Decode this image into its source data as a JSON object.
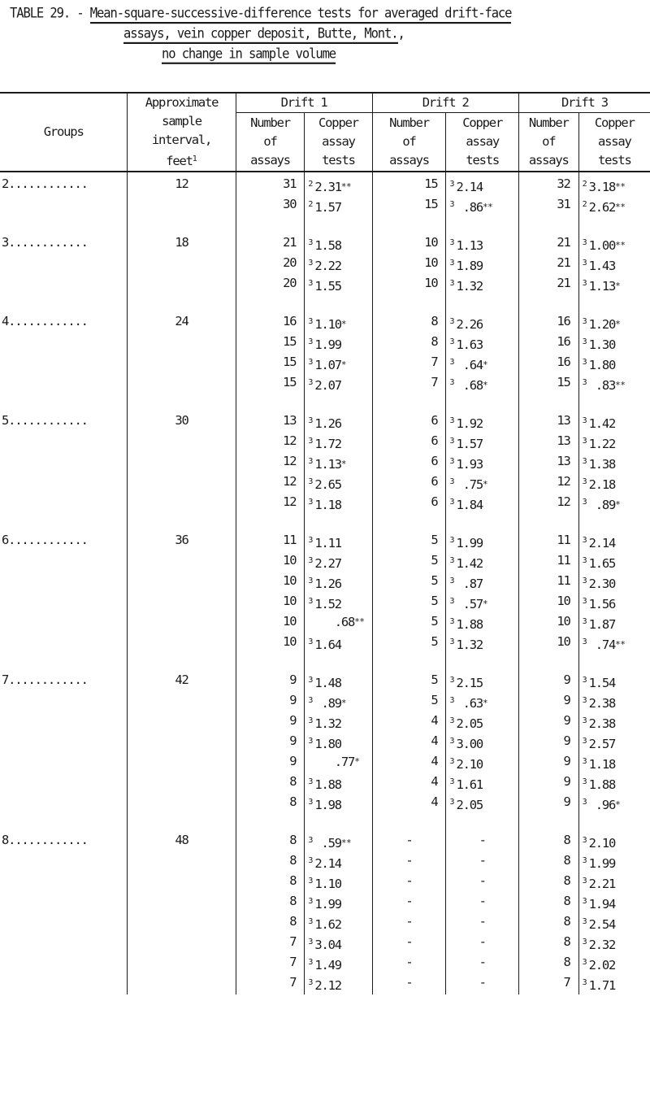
{
  "title": {
    "prefix": "TABLE 29. - ",
    "line1": "Mean-square-successive-difference tests for averaged drift-face",
    "line2": "assays, vein copper deposit, Butte, Mont.",
    "line2_suffix": ",",
    "line3": "no change in sample volume"
  },
  "headers": {
    "groups": "Groups",
    "interval_line1": "Approximate",
    "interval_line2": "sample",
    "interval_line3": "interval,",
    "interval_line4": "feet",
    "interval_footnote": "1",
    "drifts": [
      "Drift 1",
      "Drift 2",
      "Drift 3"
    ],
    "number_line1": "Number",
    "number_line2": "of",
    "number_line3": "assays",
    "copper_line1": "Copper",
    "copper_line2": "assay",
    "copper_line3": "tests"
  },
  "groups": [
    {
      "label": "2............",
      "interval": "12",
      "rows": [
        [
          {
            "n": "31"
          },
          {
            "fn": "2",
            "v": "2.31",
            "s": "**"
          },
          {
            "n": "15"
          },
          {
            "fn": "3",
            "v": "2.14",
            "s": ""
          },
          {
            "n": "32"
          },
          {
            "fn": "2",
            "v": "3.18",
            "s": "**"
          }
        ],
        [
          {
            "n": "30"
          },
          {
            "fn": "2",
            "v": "1.57",
            "s": ""
          },
          {
            "n": "15"
          },
          {
            "fn": "3",
            "v": " .86",
            "s": "**"
          },
          {
            "n": "31"
          },
          {
            "fn": "2",
            "v": "2.62",
            "s": "**"
          }
        ]
      ]
    },
    {
      "label": "3............",
      "interval": "18",
      "rows": [
        [
          {
            "n": "21"
          },
          {
            "fn": "3",
            "v": "1.58",
            "s": ""
          },
          {
            "n": "10"
          },
          {
            "fn": "3",
            "v": "1.13",
            "s": ""
          },
          {
            "n": "21"
          },
          {
            "fn": "3",
            "v": "1.00",
            "s": "**"
          }
        ],
        [
          {
            "n": "20"
          },
          {
            "fn": "3",
            "v": "2.22",
            "s": ""
          },
          {
            "n": "10"
          },
          {
            "fn": "3",
            "v": "1.89",
            "s": ""
          },
          {
            "n": "21"
          },
          {
            "fn": "3",
            "v": "1.43",
            "s": ""
          }
        ],
        [
          {
            "n": "20"
          },
          {
            "fn": "3",
            "v": "1.55",
            "s": ""
          },
          {
            "n": "10"
          },
          {
            "fn": "3",
            "v": "1.32",
            "s": ""
          },
          {
            "n": "21"
          },
          {
            "fn": "3",
            "v": "1.13",
            "s": "*"
          }
        ]
      ]
    },
    {
      "label": "4............",
      "interval": "24",
      "rows": [
        [
          {
            "n": "16"
          },
          {
            "fn": "3",
            "v": "1.10",
            "s": "*"
          },
          {
            "n": "8"
          },
          {
            "fn": "3",
            "v": "2.26",
            "s": ""
          },
          {
            "n": "16"
          },
          {
            "fn": "3",
            "v": "1.20",
            "s": "*"
          }
        ],
        [
          {
            "n": "15"
          },
          {
            "fn": "3",
            "v": "1.99",
            "s": ""
          },
          {
            "n": "8"
          },
          {
            "fn": "3",
            "v": "1.63",
            "s": ""
          },
          {
            "n": "16"
          },
          {
            "fn": "3",
            "v": "1.30",
            "s": ""
          }
        ],
        [
          {
            "n": "15"
          },
          {
            "fn": "3",
            "v": "1.07",
            "s": "*"
          },
          {
            "n": "7"
          },
          {
            "fn": "3",
            "v": " .64",
            "s": "*"
          },
          {
            "n": "16"
          },
          {
            "fn": "3",
            "v": "1.80",
            "s": ""
          }
        ],
        [
          {
            "n": "15"
          },
          {
            "fn": "3",
            "v": "2.07",
            "s": ""
          },
          {
            "n": "7"
          },
          {
            "fn": "3",
            "v": " .68",
            "s": "*"
          },
          {
            "n": "15"
          },
          {
            "fn": "3",
            "v": " .83",
            "s": "**"
          }
        ]
      ]
    },
    {
      "label": "5............",
      "interval": "30",
      "rows": [
        [
          {
            "n": "13"
          },
          {
            "fn": "3",
            "v": "1.26",
            "s": ""
          },
          {
            "n": "6"
          },
          {
            "fn": "3",
            "v": "1.92",
            "s": ""
          },
          {
            "n": "13"
          },
          {
            "fn": "3",
            "v": "1.42",
            "s": ""
          }
        ],
        [
          {
            "n": "12"
          },
          {
            "fn": "3",
            "v": "1.72",
            "s": ""
          },
          {
            "n": "6"
          },
          {
            "fn": "3",
            "v": "1.57",
            "s": ""
          },
          {
            "n": "13"
          },
          {
            "fn": "3",
            "v": "1.22",
            "s": ""
          }
        ],
        [
          {
            "n": "12"
          },
          {
            "fn": "3",
            "v": "1.13",
            "s": "*"
          },
          {
            "n": "6"
          },
          {
            "fn": "3",
            "v": "1.93",
            "s": ""
          },
          {
            "n": "13"
          },
          {
            "fn": "3",
            "v": "1.38",
            "s": ""
          }
        ],
        [
          {
            "n": "12"
          },
          {
            "fn": "3",
            "v": "2.65",
            "s": ""
          },
          {
            "n": "6"
          },
          {
            "fn": "3",
            "v": " .75",
            "s": "*"
          },
          {
            "n": "12"
          },
          {
            "fn": "3",
            "v": "2.18",
            "s": ""
          }
        ],
        [
          {
            "n": "12"
          },
          {
            "fn": "3",
            "v": "1.18",
            "s": ""
          },
          {
            "n": "6"
          },
          {
            "fn": "3",
            "v": "1.84",
            "s": ""
          },
          {
            "n": "12"
          },
          {
            "fn": "3",
            "v": " .89",
            "s": "*"
          }
        ]
      ]
    },
    {
      "label": "6............",
      "interval": "36",
      "rows": [
        [
          {
            "n": "11"
          },
          {
            "fn": "3",
            "v": "1.11",
            "s": ""
          },
          {
            "n": "5"
          },
          {
            "fn": "3",
            "v": "1.99",
            "s": ""
          },
          {
            "n": "11"
          },
          {
            "fn": "3",
            "v": "2.14",
            "s": ""
          }
        ],
        [
          {
            "n": "10"
          },
          {
            "fn": "3",
            "v": "2.27",
            "s": ""
          },
          {
            "n": "5"
          },
          {
            "fn": "3",
            "v": "1.42",
            "s": ""
          },
          {
            "n": "11"
          },
          {
            "fn": "3",
            "v": "1.65",
            "s": ""
          }
        ],
        [
          {
            "n": "10"
          },
          {
            "fn": "3",
            "v": "1.26",
            "s": ""
          },
          {
            "n": "5"
          },
          {
            "fn": "3",
            "v": " .87",
            "s": ""
          },
          {
            "n": "11"
          },
          {
            "fn": "3",
            "v": "2.30",
            "s": ""
          }
        ],
        [
          {
            "n": "10"
          },
          {
            "fn": "3",
            "v": "1.52",
            "s": ""
          },
          {
            "n": "5"
          },
          {
            "fn": "3",
            "v": " .57",
            "s": "*"
          },
          {
            "n": "10"
          },
          {
            "fn": "3",
            "v": "1.56",
            "s": ""
          }
        ],
        [
          {
            "n": "10"
          },
          {
            "fn": "",
            "v": "   .68",
            "s": "**"
          },
          {
            "n": "5"
          },
          {
            "fn": "3",
            "v": "1.88",
            "s": ""
          },
          {
            "n": "10"
          },
          {
            "fn": "3",
            "v": "1.87",
            "s": ""
          }
        ],
        [
          {
            "n": "10"
          },
          {
            "fn": "3",
            "v": "1.64",
            "s": ""
          },
          {
            "n": "5"
          },
          {
            "fn": "3",
            "v": "1.32",
            "s": ""
          },
          {
            "n": "10"
          },
          {
            "fn": "3",
            "v": " .74",
            "s": "**"
          }
        ]
      ]
    },
    {
      "label": "7............",
      "interval": "42",
      "rows": [
        [
          {
            "n": "9"
          },
          {
            "fn": "3",
            "v": "1.48",
            "s": ""
          },
          {
            "n": "5"
          },
          {
            "fn": "3",
            "v": "2.15",
            "s": ""
          },
          {
            "n": "9"
          },
          {
            "fn": "3",
            "v": "1.54",
            "s": ""
          }
        ],
        [
          {
            "n": "9"
          },
          {
            "fn": "3",
            "v": " .89",
            "s": "*"
          },
          {
            "n": "5"
          },
          {
            "fn": "3",
            "v": " .63",
            "s": "*"
          },
          {
            "n": "9"
          },
          {
            "fn": "3",
            "v": "2.38",
            "s": ""
          }
        ],
        [
          {
            "n": "9"
          },
          {
            "fn": "3",
            "v": "1.32",
            "s": ""
          },
          {
            "n": "4"
          },
          {
            "fn": "3",
            "v": "2.05",
            "s": ""
          },
          {
            "n": "9"
          },
          {
            "fn": "3",
            "v": "2.38",
            "s": ""
          }
        ],
        [
          {
            "n": "9"
          },
          {
            "fn": "3",
            "v": "1.80",
            "s": ""
          },
          {
            "n": "4"
          },
          {
            "fn": "3",
            "v": "3.00",
            "s": ""
          },
          {
            "n": "9"
          },
          {
            "fn": "3",
            "v": "2.57",
            "s": ""
          }
        ],
        [
          {
            "n": "9"
          },
          {
            "fn": "",
            "v": "   .77",
            "s": "*"
          },
          {
            "n": "4"
          },
          {
            "fn": "3",
            "v": "2.10",
            "s": ""
          },
          {
            "n": "9"
          },
          {
            "fn": "3",
            "v": "1.18",
            "s": ""
          }
        ],
        [
          {
            "n": "8"
          },
          {
            "fn": "3",
            "v": "1.88",
            "s": ""
          },
          {
            "n": "4"
          },
          {
            "fn": "3",
            "v": "1.61",
            "s": ""
          },
          {
            "n": "9"
          },
          {
            "fn": "3",
            "v": "1.88",
            "s": ""
          }
        ],
        [
          {
            "n": "8"
          },
          {
            "fn": "3",
            "v": "1.98",
            "s": ""
          },
          {
            "n": "4"
          },
          {
            "fn": "3",
            "v": "2.05",
            "s": ""
          },
          {
            "n": "9"
          },
          {
            "fn": "3",
            "v": " .96",
            "s": "*"
          }
        ]
      ]
    },
    {
      "label": "8............",
      "interval": "48",
      "rows": [
        [
          {
            "n": "8"
          },
          {
            "fn": "3",
            "v": " .59",
            "s": "**"
          },
          {
            "n": "-",
            "dash": true
          },
          {
            "v": "-",
            "dash": true
          },
          {
            "n": "8"
          },
          {
            "fn": "3",
            "v": "2.10",
            "s": ""
          }
        ],
        [
          {
            "n": "8"
          },
          {
            "fn": "3",
            "v": "2.14",
            "s": ""
          },
          {
            "n": "-",
            "dash": true
          },
          {
            "v": "-",
            "dash": true
          },
          {
            "n": "8"
          },
          {
            "fn": "3",
            "v": "1.99",
            "s": ""
          }
        ],
        [
          {
            "n": "8"
          },
          {
            "fn": "3",
            "v": "1.10",
            "s": ""
          },
          {
            "n": "-",
            "dash": true
          },
          {
            "v": "-",
            "dash": true
          },
          {
            "n": "8"
          },
          {
            "fn": "3",
            "v": "2.21",
            "s": ""
          }
        ],
        [
          {
            "n": "8"
          },
          {
            "fn": "3",
            "v": "1.99",
            "s": ""
          },
          {
            "n": "-",
            "dash": true
          },
          {
            "v": "-",
            "dash": true
          },
          {
            "n": "8"
          },
          {
            "fn": "3",
            "v": "1.94",
            "s": ""
          }
        ],
        [
          {
            "n": "8"
          },
          {
            "fn": "3",
            "v": "1.62",
            "s": ""
          },
          {
            "n": "-",
            "dash": true
          },
          {
            "v": "-",
            "dash": true
          },
          {
            "n": "8"
          },
          {
            "fn": "3",
            "v": "2.54",
            "s": ""
          }
        ],
        [
          {
            "n": "7"
          },
          {
            "fn": "3",
            "v": "3.04",
            "s": ""
          },
          {
            "n": "-",
            "dash": true
          },
          {
            "v": "-",
            "dash": true
          },
          {
            "n": "8"
          },
          {
            "fn": "3",
            "v": "2.32",
            "s": ""
          }
        ],
        [
          {
            "n": "7"
          },
          {
            "fn": "3",
            "v": "1.49",
            "s": ""
          },
          {
            "n": "-",
            "dash": true
          },
          {
            "v": "-",
            "dash": true
          },
          {
            "n": "8"
          },
          {
            "fn": "3",
            "v": "2.02",
            "s": ""
          }
        ],
        [
          {
            "n": "7"
          },
          {
            "fn": "3",
            "v": "2.12",
            "s": ""
          },
          {
            "n": "-",
            "dash": true
          },
          {
            "v": "-",
            "dash": true
          },
          {
            "n": "7"
          },
          {
            "fn": "3",
            "v": "1.71",
            "s": ""
          }
        ]
      ]
    }
  ]
}
